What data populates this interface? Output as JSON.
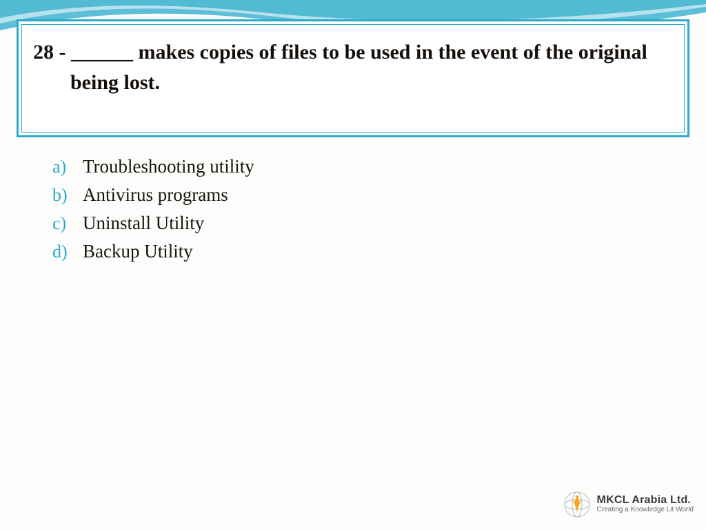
{
  "question": {
    "number": "28 -",
    "text": "______ makes copies of files to be used in the event of the original being lost."
  },
  "options": [
    {
      "letter": "a)",
      "text": "Troubleshooting utility"
    },
    {
      "letter": "b)",
      "text": "Antivirus programs"
    },
    {
      "letter": "c)",
      "text": "Uninstall Utility"
    },
    {
      "letter": "d)",
      "text": "Backup Utility"
    }
  ],
  "branding": {
    "title": "MKCL Arabia Ltd.",
    "tagline": "Creating a Knowledge Lit World"
  },
  "colors": {
    "accent": "#2aa9c9"
  }
}
